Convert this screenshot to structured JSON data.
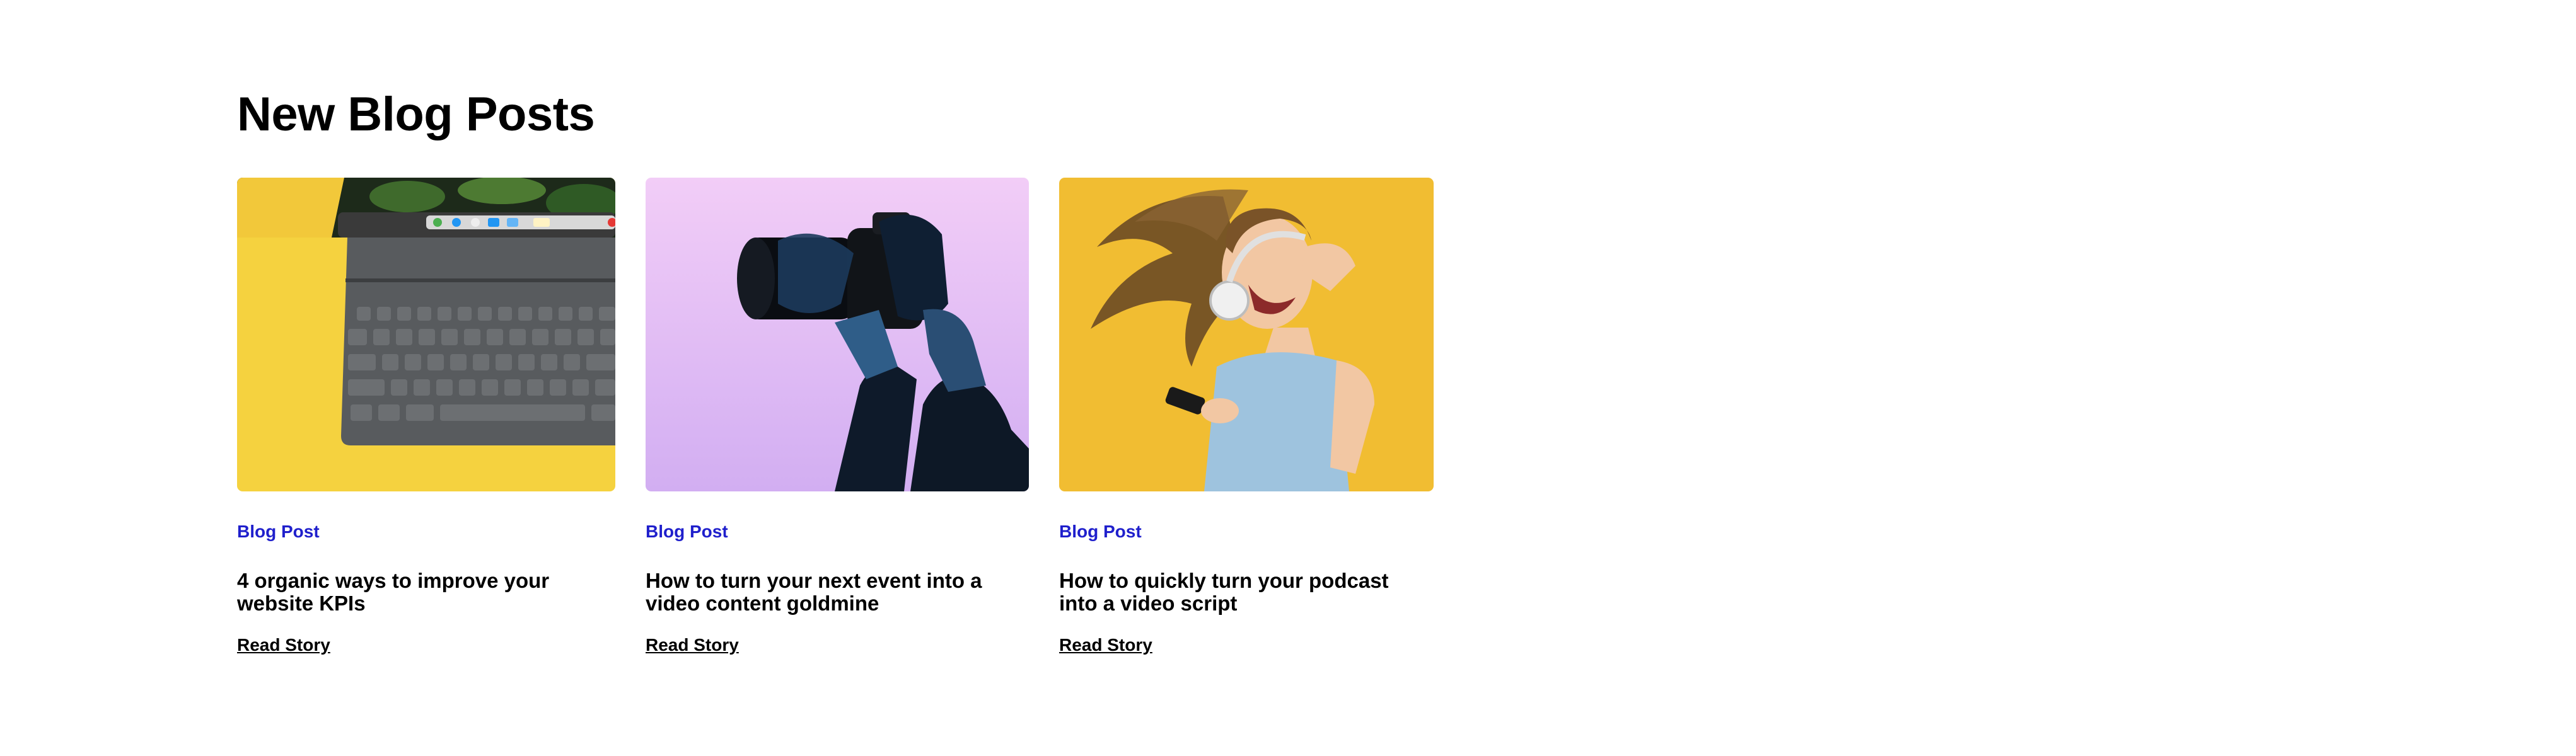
{
  "section": {
    "title": "New Blog Posts"
  },
  "colors": {
    "category": "#1f1fcc",
    "text": "#000000",
    "background": "#ffffff"
  },
  "posts": [
    {
      "category": "Blog Post",
      "title": "4 organic ways to improve your website KPIs",
      "link_label": "Read Story",
      "image": "tablet-keyboard-on-yellow-photo"
    },
    {
      "category": "Blog Post",
      "title": "How to turn your next event into a video content goldmine",
      "link_label": "Read Story",
      "image": "hands-holding-camera-on-purple-photo"
    },
    {
      "category": "Blog Post",
      "title": "How to quickly turn your podcast into a video script",
      "link_label": "Read Story",
      "image": "woman-with-headphones-on-yellow-photo"
    }
  ]
}
